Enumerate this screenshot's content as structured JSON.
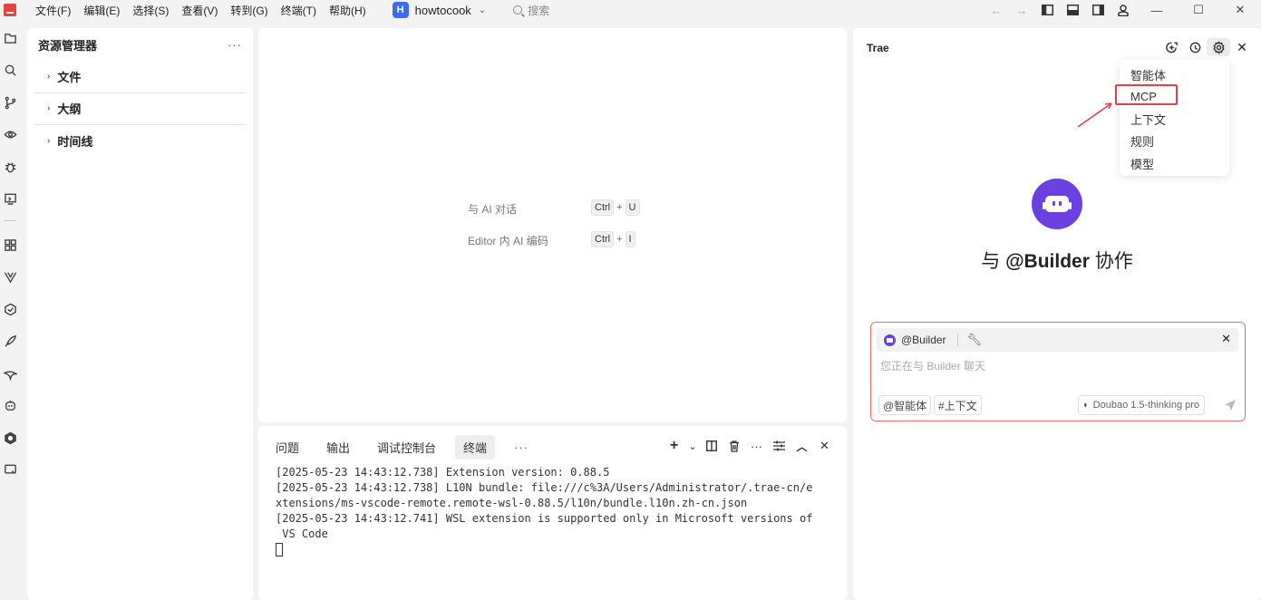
{
  "menu": [
    "文件(F)",
    "编辑(E)",
    "选择(S)",
    "查看(V)",
    "转到(G)",
    "终端(T)",
    "帮助(H)"
  ],
  "project": {
    "badge": "H",
    "name": "howtocook"
  },
  "search": {
    "label": "搜索"
  },
  "explorer": {
    "title": "资源管理器",
    "more": "···",
    "sections": [
      "文件",
      "大纲",
      "时间线"
    ]
  },
  "editor": {
    "hints": [
      {
        "label": "与 AI 对话",
        "keys": [
          "Ctrl",
          "U"
        ]
      },
      {
        "label": "Editor 内 AI 编码",
        "keys": [
          "Ctrl",
          "I"
        ]
      }
    ]
  },
  "panel": {
    "tabs": [
      "问题",
      "输出",
      "调试控制台",
      "终端"
    ],
    "active_tab": "终端",
    "more": "···",
    "terminal_lines": [
      "[2025-05-23 14:43:12.738] Extension version: 0.88.5",
      "[2025-05-23 14:43:12.738] L10N bundle: file:///c%3A/Users/Administrator/.trae-cn/e",
      "xtensions/ms-vscode-remote.remote-wsl-0.88.5/l10n/bundle.l10n.zh-cn.json",
      "[2025-05-23 14:43:12.741] WSL extension is supported only in Microsoft versions of",
      " VS Code"
    ]
  },
  "ai": {
    "title": "Trae",
    "settings_menu": [
      "智能体",
      "MCP",
      "上下文",
      "规则",
      "模型"
    ],
    "highlighted_item": "MCP",
    "collab_prefix": "与 ",
    "collab_name": "@Builder",
    "collab_suffix": " 协作",
    "chat": {
      "agent": "@Builder",
      "placeholder": "您正在与 Builder 聊天",
      "chip_agent": "@智能体",
      "chip_context": "#上下文",
      "model": "Doubao 1.5-thinking pro"
    },
    "colors": {
      "accent": "#6c3fe0",
      "highlight": "#e0404d"
    }
  }
}
